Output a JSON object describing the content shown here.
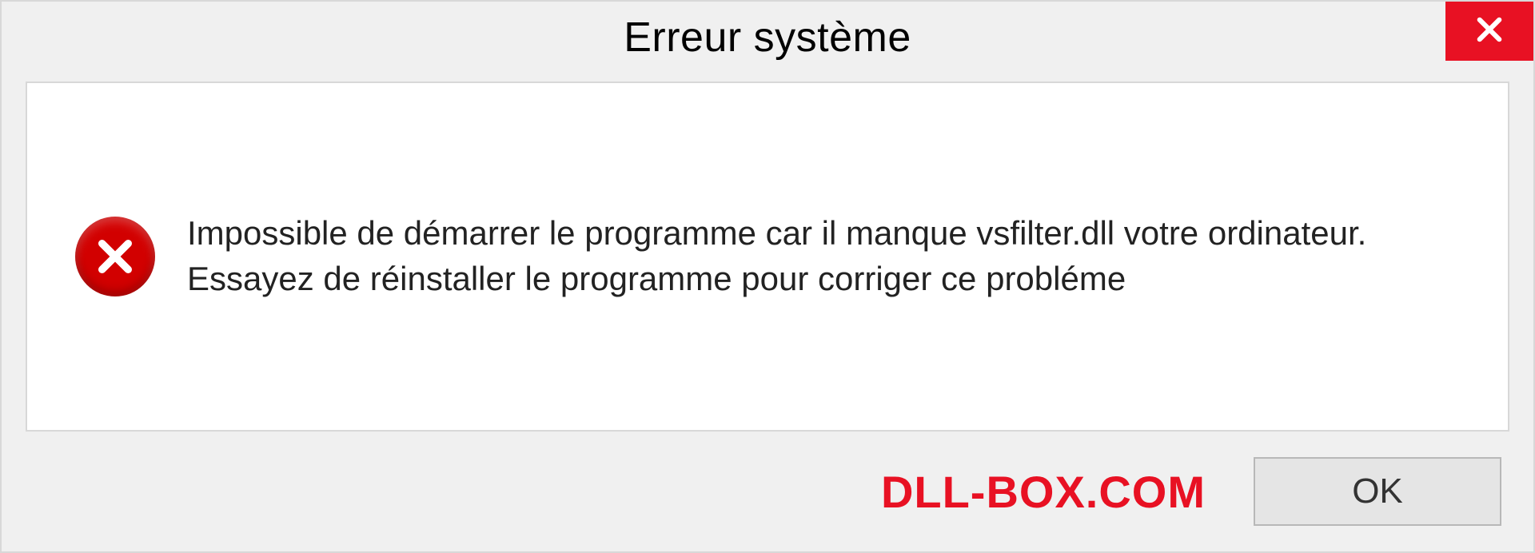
{
  "titlebar": {
    "title": "Erreur système"
  },
  "content": {
    "message": "Impossible de démarrer le programme car il manque vsfilter.dll votre ordinateur. Essayez de réinstaller le programme pour corriger ce probléme"
  },
  "footer": {
    "brand": "DLL-BOX.COM",
    "ok_label": "OK"
  }
}
